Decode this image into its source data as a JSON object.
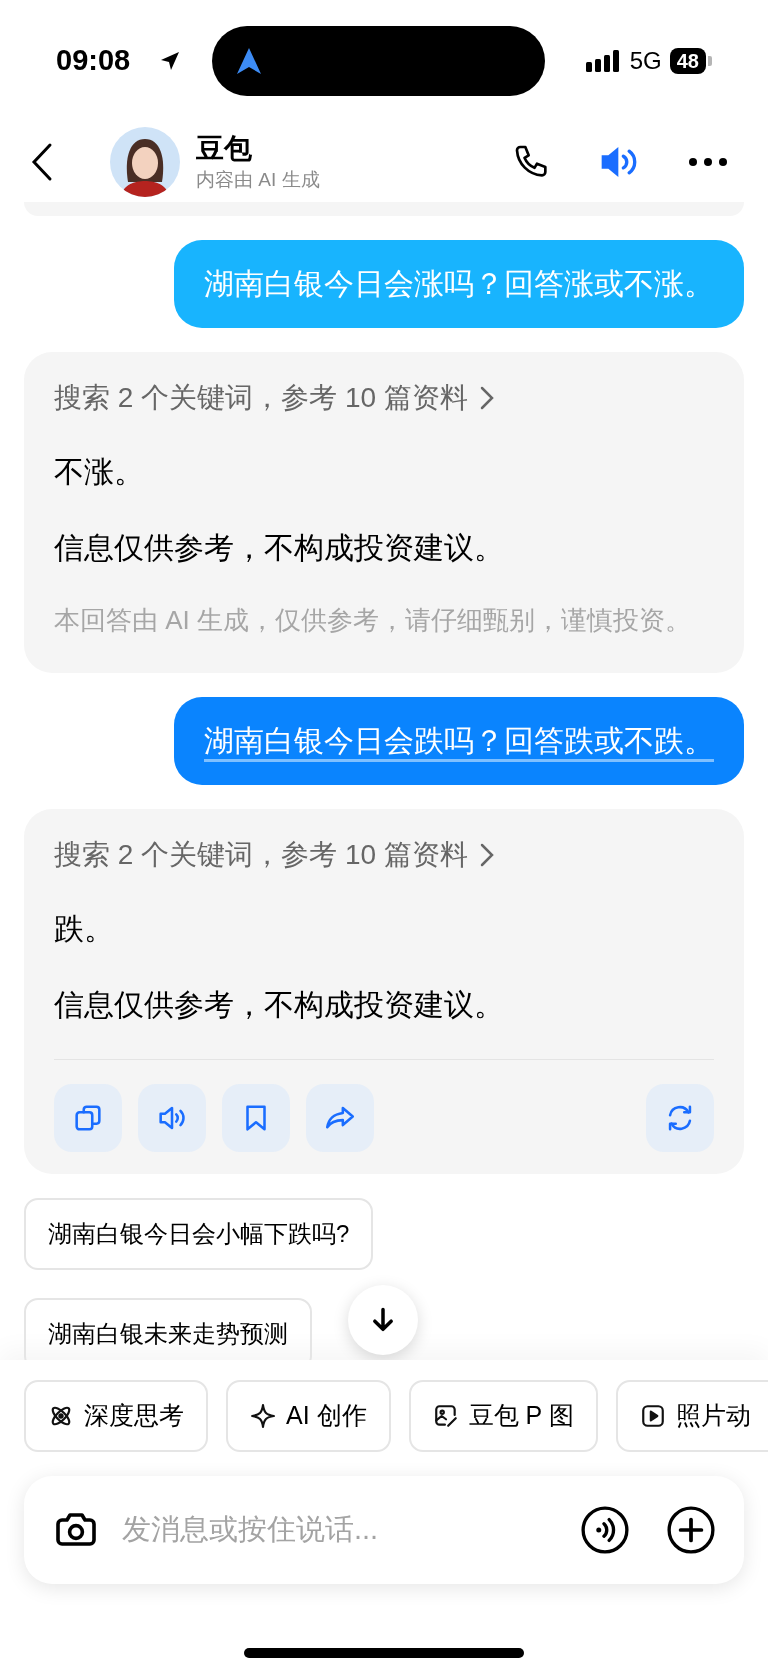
{
  "status_bar": {
    "time": "09:08",
    "network": "5G",
    "battery": "48"
  },
  "header": {
    "title": "豆包",
    "subtitle": "内容由 AI 生成",
    "speaker_on": true
  },
  "messages": [
    {
      "kind": "user",
      "text": "湖南白银今日会涨吗？回答涨或不涨。",
      "selected": false
    },
    {
      "kind": "assistant",
      "search": "搜索 2 个关键词，参考 10 篇资料",
      "paragraphs": [
        "不涨。",
        "信息仅供参考，不构成投资建议。"
      ],
      "disclaimer": "本回答由 AI 生成，仅供参考，请仔细甄别，谨慎投资。",
      "toolbar": false
    },
    {
      "kind": "user",
      "text": "湖南白银今日会跌吗？回答跌或不跌。",
      "selected": true
    },
    {
      "kind": "assistant",
      "search": "搜索 2 个关键词，参考 10 篇资料",
      "paragraphs": [
        "跌。",
        "信息仅供参考，不构成投资建议。"
      ],
      "toolbar": true
    }
  ],
  "suggestions": [
    "湖南白银今日会小幅下跌吗?",
    "湖南白银未来走势预测"
  ],
  "tools": [
    {
      "kind": "think",
      "label": "深度思考"
    },
    {
      "kind": "create",
      "label": "AI 创作"
    },
    {
      "kind": "edit",
      "label": "豆包 P 图"
    },
    {
      "kind": "animate",
      "label": "照片动"
    }
  ],
  "input": {
    "placeholder": "发消息或按住说话..."
  }
}
